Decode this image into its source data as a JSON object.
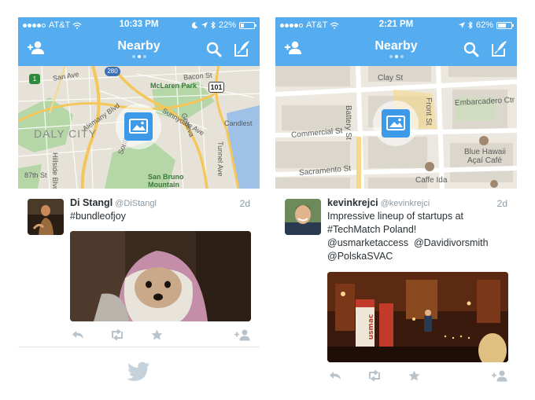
{
  "colors": {
    "header": "#55acee",
    "link": "#55acee",
    "muted": "#8899a6",
    "text": "#292f33",
    "map_water": "#9fc1e8",
    "map_park": "#b5d6a7"
  },
  "left": {
    "status": {
      "carrier": "AT&T",
      "time": "10:33 PM",
      "battery": "22%",
      "battery_level": 0.22
    },
    "header": {
      "title": "Nearby",
      "page_count": 3,
      "active_page": 1
    },
    "icons": [
      "add-user-icon",
      "search-icon",
      "compose-icon"
    ],
    "map": {
      "labels": {
        "sanave": "San Ave",
        "bacon": "Bacon St",
        "mclaren": "McLaren Park",
        "alemany": "Alemany Blvd",
        "sunnydale": "Sunnydale Ave",
        "candlest": "Candlest",
        "daly": "DALY CITY",
        "hillside": "Hillside Blvd",
        "tunnel": "Tunnel Ave",
        "st87": "87th St",
        "sanbruno": "San Bruno",
        "mountain": "Mountain",
        "r280": "280",
        "r101": "101",
        "r1": "1",
        "south": "South",
        "geneva": "Geneva"
      }
    },
    "tweet": {
      "name": "Di Stangl",
      "handle": "@DiStangl",
      "time": "2d",
      "text": "#bundleofjoy"
    },
    "footer_icon": "twitter-bird-icon"
  },
  "right": {
    "status": {
      "carrier": "AT&T",
      "time": "2:21 PM",
      "battery": "62%",
      "battery_level": 0.62
    },
    "header": {
      "title": "Nearby",
      "page_count": 3,
      "active_page": 1
    },
    "icons": [
      "add-user-icon",
      "search-icon",
      "compose-icon"
    ],
    "map": {
      "labels": {
        "clay": "Clay St",
        "embarcadero": "Embarcadero Ctr",
        "commercial": "Commercial St",
        "battery": "Battery St",
        "front": "Front St",
        "sacramento": "Sacramento St",
        "bluehawaii": "Blue Hawaii",
        "acai": "Açaí Café",
        "caffeida": "Caffe Ida"
      }
    },
    "tweet": {
      "name": "kevinkrejci",
      "handle": "@kevinkrejci",
      "time": "2d",
      "line1": "Impressive lineup of startups at",
      "line2": "#TechMatch Poland!",
      "mention1": "@usmarketaccess",
      "mention2": "@Davidivorsmith",
      "mention3": "@PolskaSVAC",
      "sign": "usmac"
    }
  }
}
